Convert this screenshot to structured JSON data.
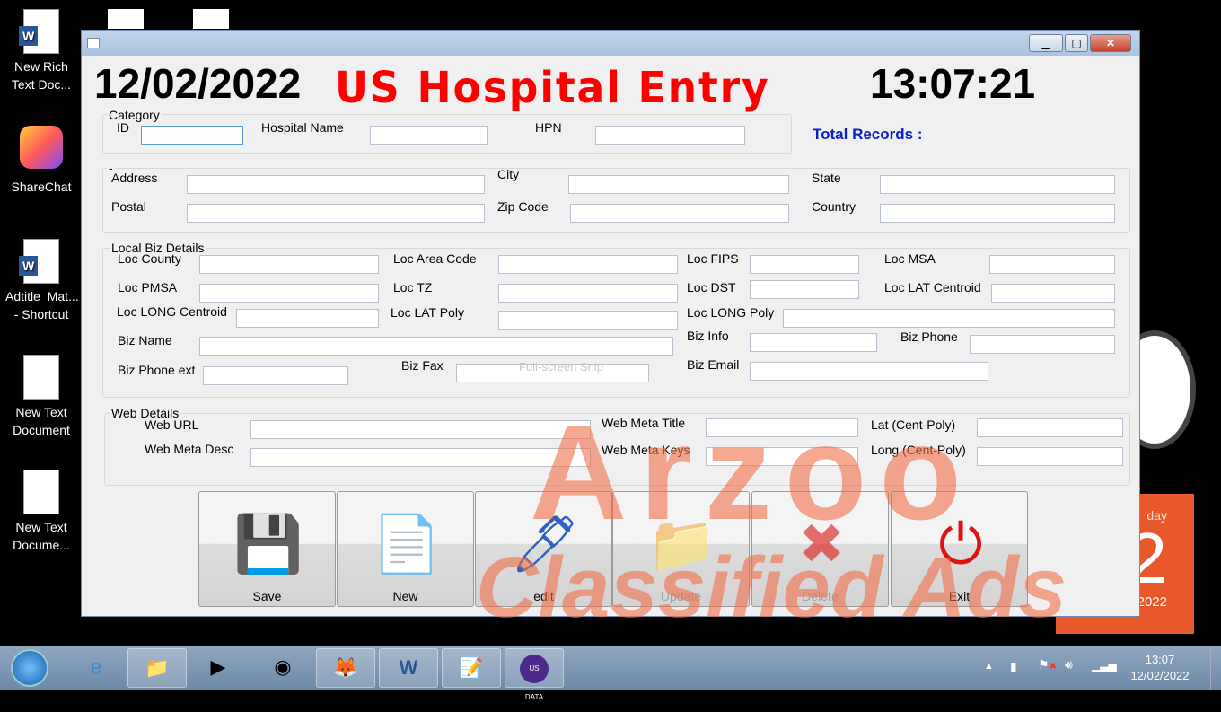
{
  "desktop": {
    "icons": [
      {
        "label": "New Rich Text Doc...",
        "type": "word"
      },
      {
        "label": "ShareChat",
        "type": "app"
      },
      {
        "label": "Adtitle_Mat... - Shortcut",
        "type": "word"
      },
      {
        "label": "New Text Document",
        "type": "text"
      },
      {
        "label": "New Text Docume...",
        "type": "text"
      }
    ],
    "calendar_month": "February 2022",
    "calendar_day": "2",
    "calendar_weekday": "day"
  },
  "window": {
    "date": "12/02/2022",
    "title": "US Hospital Entry",
    "time": "13:07:21",
    "title_color": "#ff0000",
    "total_records_label": "Total Records :",
    "total_records_value": "–",
    "groups": {
      "category": "Category",
      "address": "-",
      "local_biz": "Local  Biz Details",
      "web": "Web Details"
    },
    "fields": [
      {
        "label": "ID",
        "value": ""
      },
      {
        "label": "Hospital Name",
        "value": ""
      },
      {
        "label": "HPN",
        "value": ""
      },
      {
        "label": "Address",
        "value": ""
      },
      {
        "label": "City",
        "value": ""
      },
      {
        "label": "State",
        "value": ""
      },
      {
        "label": "Postal",
        "value": ""
      },
      {
        "label": "Zip Code",
        "value": ""
      },
      {
        "label": "Country",
        "value": ""
      },
      {
        "label": "Loc County",
        "value": ""
      },
      {
        "label": "Loc Area Code",
        "value": ""
      },
      {
        "label": "Loc FIPS",
        "value": ""
      },
      {
        "label": "Loc MSA",
        "value": ""
      },
      {
        "label": "Loc PMSA",
        "value": ""
      },
      {
        "label": "Loc TZ",
        "value": ""
      },
      {
        "label": "Loc DST",
        "value": ""
      },
      {
        "label": "Loc LAT Centroid",
        "value": ""
      },
      {
        "label": "Loc LONG Centroid",
        "value": ""
      },
      {
        "label": "Loc LAT Poly",
        "value": ""
      },
      {
        "label": "Loc LONG Poly",
        "value": ""
      },
      {
        "label": "Biz Name",
        "value": ""
      },
      {
        "label": "Biz Info",
        "value": ""
      },
      {
        "label": "Biz Phone",
        "value": ""
      },
      {
        "label": "Biz Phone ext",
        "value": ""
      },
      {
        "label": "Biz Fax",
        "value": ""
      },
      {
        "label": "Biz Email",
        "value": ""
      },
      {
        "label": "Web URL",
        "value": ""
      },
      {
        "label": "Web Meta Title",
        "value": ""
      },
      {
        "label": "Lat (Cent-Poly)",
        "value": ""
      },
      {
        "label": "Web Meta Desc",
        "value": ""
      },
      {
        "label": "Web Meta Keys",
        "value": ""
      },
      {
        "label": "Long (Cent-Poly)",
        "value": ""
      }
    ],
    "snip_hint": "Full-screen Snip",
    "buttons": [
      {
        "label": "Save",
        "icon": "floppy-disk-icon",
        "glyph": "💾",
        "enabled": true
      },
      {
        "label": "New",
        "icon": "new-document-icon",
        "glyph": "📄",
        "enabled": true
      },
      {
        "label": "edit",
        "icon": "marker-pen-icon",
        "glyph": "🖊",
        "enabled": true
      },
      {
        "label": "Update",
        "icon": "refresh-folder-icon",
        "glyph": "📁",
        "enabled": false
      },
      {
        "label": "Delete",
        "icon": "red-x-icon",
        "glyph": "✖",
        "enabled": false
      },
      {
        "label": "Exit",
        "icon": "power-icon",
        "glyph": "⏻",
        "enabled": true
      }
    ]
  },
  "watermark": {
    "line1": "Arzoo",
    "line2": "Classified Ads"
  },
  "taskbar": {
    "apps": [
      "ie",
      "explorer",
      "media-player",
      "chrome",
      "firefox",
      "word",
      "notepad",
      "us-data"
    ],
    "us_data_label": "US DATA",
    "clock_time": "13:07",
    "clock_date": "12/02/2022"
  }
}
